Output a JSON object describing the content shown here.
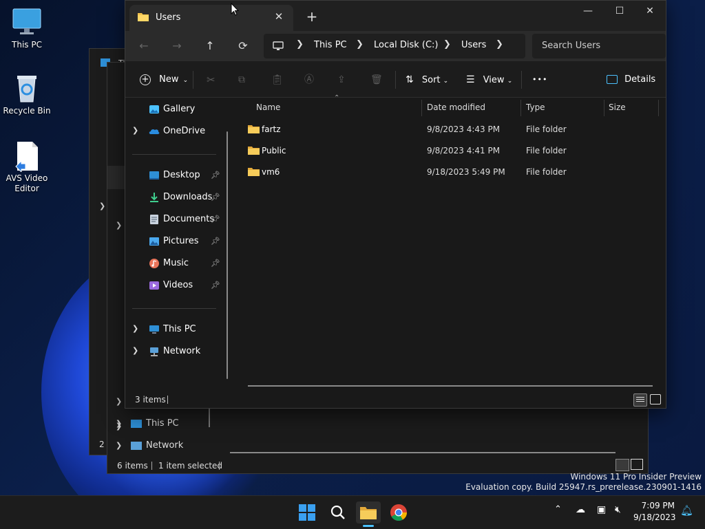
{
  "desktop": {
    "icons": [
      {
        "label": "This PC"
      },
      {
        "label": "Recycle Bin"
      },
      {
        "label_line1": "AVS Video",
        "label_line2": "Editor"
      }
    ]
  },
  "bg_window": {
    "title_fragment": "Ti",
    "nav": [
      {
        "label": "This PC"
      },
      {
        "label": "Network"
      }
    ],
    "status_count": "6 items",
    "status_selected": "1 item selected",
    "left_fragment": "2 i"
  },
  "explorer": {
    "tab_title": "Users",
    "tab_close": "✕",
    "new_tab": "+",
    "window_controls": {
      "minimize": "—",
      "maximize": "☐",
      "close": "✕"
    },
    "nav": {
      "back": "←",
      "forward": "→",
      "up": "↑",
      "refresh": "⟳"
    },
    "breadcrumb": [
      "This PC",
      "Local Disk (C:)",
      "Users"
    ],
    "search_placeholder": "Search Users",
    "commands": {
      "new_label": "New",
      "sort_label": "Sort",
      "view_label": "View",
      "more_label": "•••",
      "details_label": "Details"
    },
    "sidebar": {
      "gallery": "Gallery",
      "onedrive": "OneDrive",
      "quick_access": [
        {
          "label": "Desktop"
        },
        {
          "label": "Downloads"
        },
        {
          "label": "Documents"
        },
        {
          "label": "Pictures"
        },
        {
          "label": "Music"
        },
        {
          "label": "Videos"
        }
      ],
      "this_pc": "This PC",
      "network": "Network"
    },
    "columns": {
      "name": "Name",
      "date": "Date modified",
      "type": "Type",
      "size": "Size"
    },
    "files": [
      {
        "name": "fartz",
        "date": "9/8/2023 4:43 PM",
        "type": "File folder"
      },
      {
        "name": "Public",
        "date": "9/8/2023 4:41 PM",
        "type": "File folder"
      },
      {
        "name": "vm6",
        "date": "9/18/2023 5:49 PM",
        "type": "File folder"
      }
    ],
    "status_count": "3 items"
  },
  "watermark": {
    "line1": "Windows 11 Pro Insider Preview",
    "line2": "Evaluation copy. Build 25947.rs_prerelease.230901-1416"
  },
  "taskbar": {
    "time": "7:09 PM",
    "date": "9/18/2023"
  },
  "colors": {
    "accent": "#4cc2ff",
    "folder": "#f2c14e",
    "window_bg": "#191919"
  }
}
